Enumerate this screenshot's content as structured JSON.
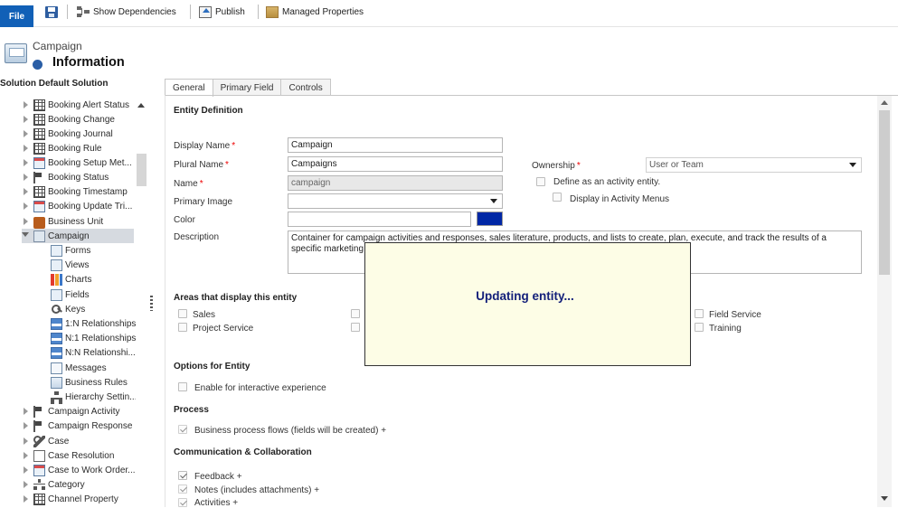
{
  "toolbar": {
    "file_label": "File",
    "save_icon": "save-icon",
    "show_dependencies_label": "Show Dependencies",
    "publish_label": "Publish",
    "managed_properties_label": "Managed Properties"
  },
  "header": {
    "entity_label": "Campaign",
    "page_title": "Information"
  },
  "sidebar": {
    "solution_title": "Solution Default Solution",
    "items": [
      {
        "label": "Booking Alert Status",
        "icon": "grid-icon"
      },
      {
        "label": "Booking Change",
        "icon": "grid-icon"
      },
      {
        "label": "Booking Journal",
        "icon": "grid-icon"
      },
      {
        "label": "Booking Rule",
        "icon": "grid-icon"
      },
      {
        "label": "Booking Setup Met...",
        "icon": "settings-icon"
      },
      {
        "label": "Booking Status",
        "icon": "flag-icon"
      },
      {
        "label": "Booking Timestamp",
        "icon": "grid-icon"
      },
      {
        "label": "Booking Update Tri...",
        "icon": "settings-icon"
      },
      {
        "label": "Business Unit",
        "icon": "briefcase-icon"
      },
      {
        "label": "Campaign",
        "icon": "campaign-icon"
      },
      {
        "label": "Forms",
        "icon": "form-icon"
      },
      {
        "label": "Views",
        "icon": "view-icon"
      },
      {
        "label": "Charts",
        "icon": "chart-icon"
      },
      {
        "label": "Fields",
        "icon": "field-icon"
      },
      {
        "label": "Keys",
        "icon": "key-icon"
      },
      {
        "label": "1:N Relationships",
        "icon": "relationship-icon"
      },
      {
        "label": "N:1 Relationships",
        "icon": "relationship-icon"
      },
      {
        "label": "N:N Relationshi...",
        "icon": "relationship-icon"
      },
      {
        "label": "Messages",
        "icon": "message-icon"
      },
      {
        "label": "Business Rules",
        "icon": "rule-icon"
      },
      {
        "label": "Hierarchy Settin...",
        "icon": "hierarchy-icon"
      },
      {
        "label": "Campaign Activity",
        "icon": "megaphone-icon"
      },
      {
        "label": "Campaign Response",
        "icon": "megaphone-icon"
      },
      {
        "label": "Case",
        "icon": "wrench-icon"
      },
      {
        "label": "Case Resolution",
        "icon": "document-icon"
      },
      {
        "label": "Case to Work Order...",
        "icon": "settings-icon"
      },
      {
        "label": "Category",
        "icon": "category-icon"
      },
      {
        "label": "Channel Property",
        "icon": "grid-icon"
      }
    ]
  },
  "tabs": [
    {
      "label": "General"
    },
    {
      "label": "Primary Field"
    },
    {
      "label": "Controls"
    }
  ],
  "form": {
    "entity_definition_title": "Entity Definition",
    "display_name_label": "Display Name",
    "display_name_value": "Campaign",
    "plural_name_label": "Plural Name",
    "plural_name_value": "Campaigns",
    "name_label": "Name",
    "name_value": "campaign",
    "primary_image_label": "Primary Image",
    "primary_image_value": "",
    "color_label": "Color",
    "color_value": "",
    "color_swatch": "#0027a5",
    "description_label": "Description",
    "description_value": "Container for campaign activities and responses, sales literature, products, and lists to create, plan, execute, and track the results of a specific marketing campaign",
    "ownership_label": "Ownership",
    "ownership_value": "User or Team",
    "activity_entity_label": "Define as an activity entity.",
    "activity_menus_label": "Display in Activity Menus",
    "required_marker": "*"
  },
  "areas": {
    "title": "Areas that display this entity",
    "sales": "Sales",
    "project_service": "Project Service",
    "field_service": "Field Service",
    "training": "Training"
  },
  "options": {
    "title": "Options for Entity",
    "interactive_label": "Enable for interactive experience"
  },
  "process": {
    "title": "Process",
    "bpf_label": "Business process flows (fields will be created)",
    "plus": "+"
  },
  "communication": {
    "title": "Communication & Collaboration",
    "feedback_label": "Feedback",
    "notes_label": "Notes (includes attachments)",
    "activities_label": "Activities",
    "plus": "+"
  },
  "overlay": {
    "message": "Updating entity..."
  }
}
